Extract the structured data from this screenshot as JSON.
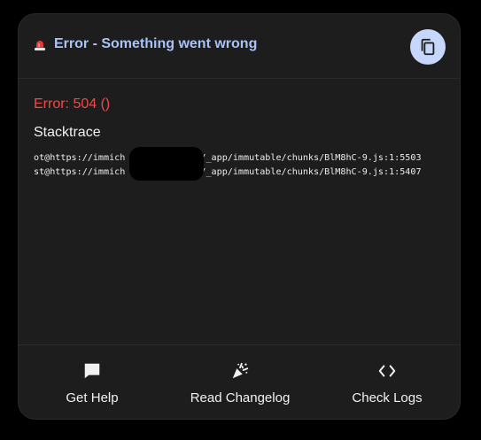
{
  "header": {
    "title": "Error - Something went wrong",
    "copy_icon": "copy-icon",
    "alert_icon": "siren-icon"
  },
  "error": {
    "message": "Error: 504 ()"
  },
  "stacktrace": {
    "heading": "Stacktrace",
    "lines": [
      "ot@https://immich              /_app/immutable/chunks/BlM8hC-9.js:1:5503",
      "st@https://immich              /_app/immutable/chunks/BlM8hC-9.js:1:5407"
    ]
  },
  "footer": {
    "buttons": [
      {
        "label": "Get Help",
        "icon": "chat-icon"
      },
      {
        "label": "Read Changelog",
        "icon": "party-popper-icon"
      },
      {
        "label": "Check Logs",
        "icon": "code-icon"
      }
    ]
  },
  "colors": {
    "background": "#000000",
    "card": "#1d1d1e",
    "title": "#a9c2f7",
    "error": "#ef4a4a",
    "copy_button": "#c7d7fb"
  }
}
